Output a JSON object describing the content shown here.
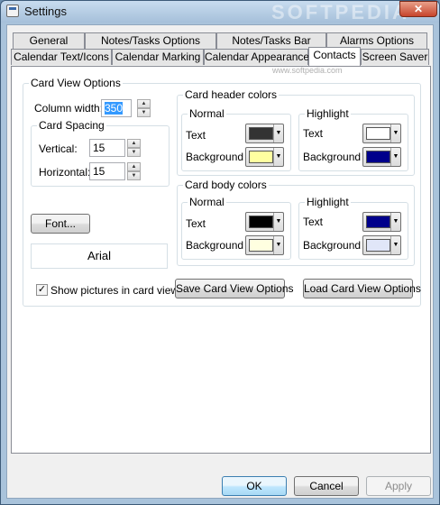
{
  "window": {
    "title": "Settings",
    "close_glyph": "✕",
    "watermark": "SOFTPEDIA"
  },
  "tabs": {
    "row1": [
      "General",
      "Notes/Tasks Options",
      "Notes/Tasks Bar",
      "Alarms Options"
    ],
    "row2": [
      "Calendar Text/Icons",
      "Calendar Marking",
      "Calendar Appearance",
      "Contacts",
      "Screen Saver"
    ],
    "active": "Contacts",
    "overlay": "www.softpedia.com"
  },
  "card_view": {
    "legend": "Card View Options",
    "column_width_label": "Column width:",
    "column_width_value": "350",
    "spacing_legend": "Card Spacing",
    "vertical_label": "Vertical:",
    "vertical_value": "15",
    "horizontal_label": "Horizontal:",
    "horizontal_value": "15",
    "font_button": "Font...",
    "font_name": "Arial",
    "show_pictures_label": "Show pictures in card view",
    "show_pictures_checked": true,
    "check_glyph": "✓",
    "save_button": "Save Card View Options",
    "load_button": "Load Card View Options"
  },
  "header_colors": {
    "legend": "Card header colors",
    "normal": {
      "legend": "Normal",
      "text_label": "Text",
      "text_color": "#333333",
      "background_label": "Background",
      "background_color": "#ffffa0"
    },
    "highlight": {
      "legend": "Highlight",
      "text_label": "Text",
      "text_color": "#ffffff",
      "background_label": "Background",
      "background_color": "#00008b"
    }
  },
  "body_colors": {
    "legend": "Card body colors",
    "normal": {
      "legend": "Normal",
      "text_label": "Text",
      "text_color": "#000000",
      "background_label": "Background",
      "background_color": "#ffffe0"
    },
    "highlight": {
      "legend": "Highlight",
      "text_label": "Text",
      "text_color": "#00008b",
      "background_label": "Background",
      "background_color": "#e0e6f8"
    }
  },
  "spin_up": "▲",
  "spin_down": "▼",
  "dropdown_arrow": "▼",
  "footer": {
    "ok": "OK",
    "cancel": "Cancel",
    "apply": "Apply"
  }
}
